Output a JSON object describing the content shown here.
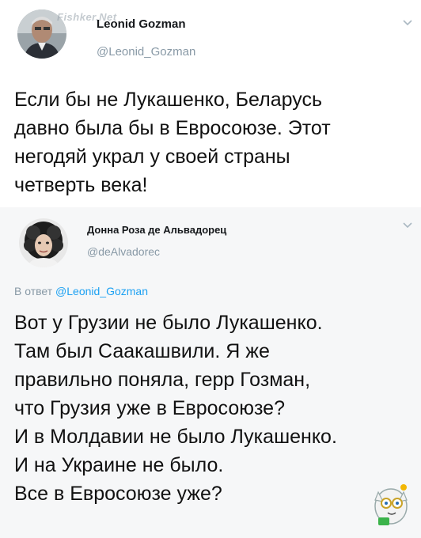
{
  "tweet1": {
    "name": "Leonid Gozman",
    "handle": "@Leonid_Gozman",
    "lines": [
      "Если бы не Лукашенко, Беларусь",
      "давно была бы в Евросоюзе. Этот",
      "негодяй украл у своей страны",
      "четверть века!"
    ],
    "menu_icon": "chevron-down-icon",
    "watermark": "Fishker.Net"
  },
  "tweet2": {
    "name": "Донна Роза де Альвадорец",
    "handle": "@deAlvadorec",
    "reply_prefix": "В ответ",
    "reply_handle": "@Leonid_Gozman",
    "lines": [
      "Вот у Грузии не было Лукашенко.",
      "Там был Саакашвили. Я же",
      "правильно поняла, герр Гозман,",
      "что Грузия уже в Евросоюзе?",
      "И в Молдавии не было Лукашенко.",
      "И на Украине не было.",
      "Все в Евросоюзе уже?"
    ],
    "menu_icon": "chevron-down-icon"
  },
  "colors": {
    "handle": "#8899a6",
    "link": "#1da1f2",
    "reply_bg": "#f6f7f8"
  }
}
